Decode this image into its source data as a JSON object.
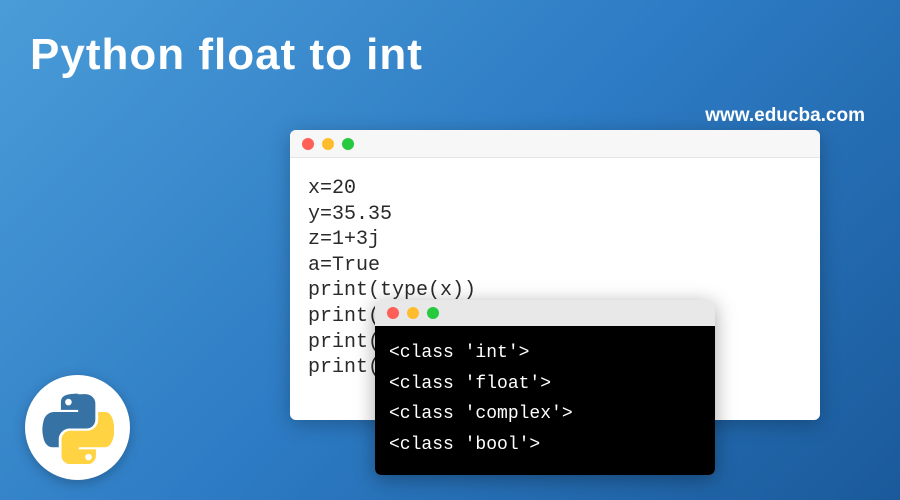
{
  "title": "Python float to int",
  "website": "www.educba.com",
  "code_window": {
    "lines": [
      "x=20",
      "y=35.35",
      "z=1+3j",
      "a=True",
      "print(type(x))",
      "print(type(y))",
      "print(type(z))",
      "print(type(a))"
    ]
  },
  "terminal_window": {
    "lines": [
      "<class 'int'>",
      "<class 'float'>",
      "<class 'complex'>",
      "<class 'bool'>"
    ]
  },
  "logo_name": "python-logo"
}
